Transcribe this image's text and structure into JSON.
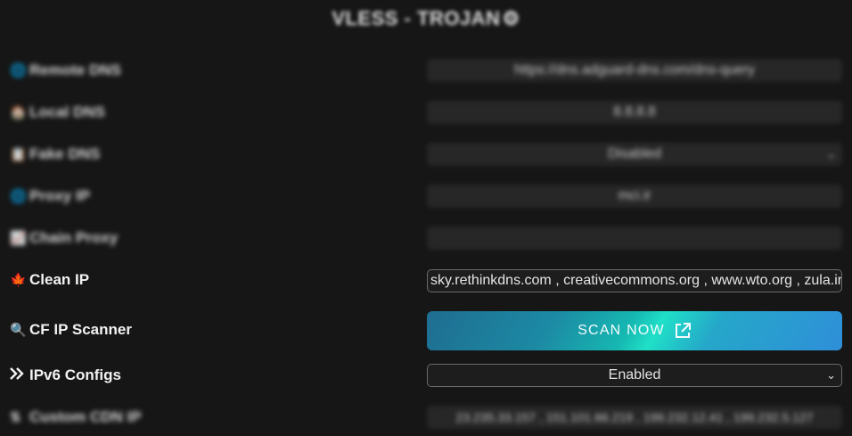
{
  "header": {
    "title": "VLESS - TROJAN",
    "icon": "gear-icon"
  },
  "settings": {
    "remote_dns": {
      "label": "Remote DNS",
      "icon": "globe-icon",
      "value": "https://dns.adguard-dns.com/dns-query"
    },
    "local_dns": {
      "label": "Local DNS",
      "icon": "house-icon",
      "value": "8.8.8.8"
    },
    "fake_dns": {
      "label": "Fake DNS",
      "icon": "document-icon",
      "value": "Disabled"
    },
    "proxy_ip": {
      "label": "Proxy IP",
      "icon": "globe-icon",
      "value": "mci.ir"
    },
    "chain_proxy": {
      "label": "Chain Proxy",
      "icon": "chart-icon",
      "value": ""
    },
    "clean_ip": {
      "label": "Clean IP",
      "icon": "leaf-icon",
      "value": "sky.rethinkdns.com , creativecommons.org , www.wto.org , zula.ir"
    },
    "cf_ip_scanner": {
      "label": "CF IP Scanner",
      "icon": "magnifier-icon",
      "button_label": "SCAN NOW",
      "button_icon": "external-link-icon"
    },
    "ipv6_configs": {
      "label": "IPv6 Configs",
      "icon": "chevrons-icon",
      "value": "Enabled"
    },
    "custom_cdn_ip": {
      "label": "Custom CDN IP",
      "icon": "sort-icon",
      "value": "23.235.33.157 , 151.101.66.219 , 199.232.12.41 , 199.232.5.127"
    }
  },
  "colors": {
    "background": "#161616",
    "field_bg": "#262626",
    "accent_leaf": "#3fb58c",
    "button_gradient_start": "#1f6d91",
    "button_gradient_mid": "#1fe0c7",
    "button_gradient_end": "#2f8fd9"
  }
}
